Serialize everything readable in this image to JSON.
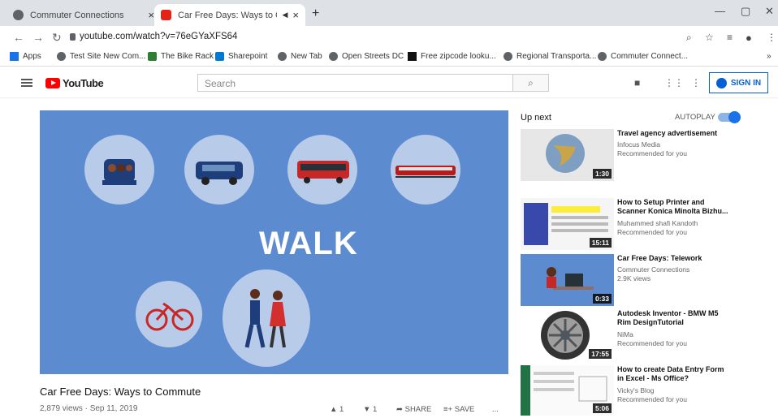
{
  "browser": {
    "tabs": [
      {
        "label": "Commuter Connections",
        "close": "×"
      },
      {
        "label": "Car Free Days: Ways to Com",
        "close": "×"
      }
    ],
    "new_tab": "+",
    "url": "youtube.com/watch?v=76eGYaXFS64",
    "bookmarks": [
      "Apps",
      "Test Site New Com...",
      "The Bike Rack",
      "Sharepoint",
      "New Tab",
      "Open Streets DC",
      "Free zipcode looku...",
      "Regional Transporta...",
      "Commuter Connect..."
    ],
    "bookmark_more": "»"
  },
  "youtube": {
    "logo": "YouTube",
    "search_placeholder": "Search",
    "signin": "SIGN IN"
  },
  "video": {
    "overlay_text": "WALK",
    "title": "Car Free Days: Ways to Commute",
    "meta": "2,879 views · Sep 11, 2019",
    "likes": "1",
    "dislikes": "1",
    "share": "SHARE",
    "save": "SAVE",
    "more": "..."
  },
  "sidebar": {
    "up_next": "Up next",
    "autoplay": "AUTOPLAY",
    "autoplay_on": true,
    "items": [
      {
        "title": "Travel agency advertisement",
        "channel": "Infocus Media",
        "meta": "Recommended for you",
        "duration": "1:30"
      },
      {
        "title": "How to Setup Printer and Scanner Konica Minolta Bizhu...",
        "channel": "Muhammed shafi Kandoth",
        "meta": "Recommended for you",
        "duration": "15:11"
      },
      {
        "title": "Car Free Days: Telework",
        "channel": "Commuter Connections",
        "meta": "2.9K views",
        "duration": "0:33"
      },
      {
        "title": "Autodesk Inventor - BMW M5 Rim DesignTutorial",
        "channel": "NiMa",
        "meta": "Recommended for you",
        "duration": "17:55"
      },
      {
        "title": "How to create Data Entry Form in Excel - Ms Office?",
        "channel": "Vicky's Blog",
        "meta": "Recommended for you",
        "duration": "5:06"
      }
    ]
  },
  "colors": {
    "accent": "#065fd4",
    "brand_red": "#ff0000",
    "video_bg": "#5d8bd0"
  }
}
